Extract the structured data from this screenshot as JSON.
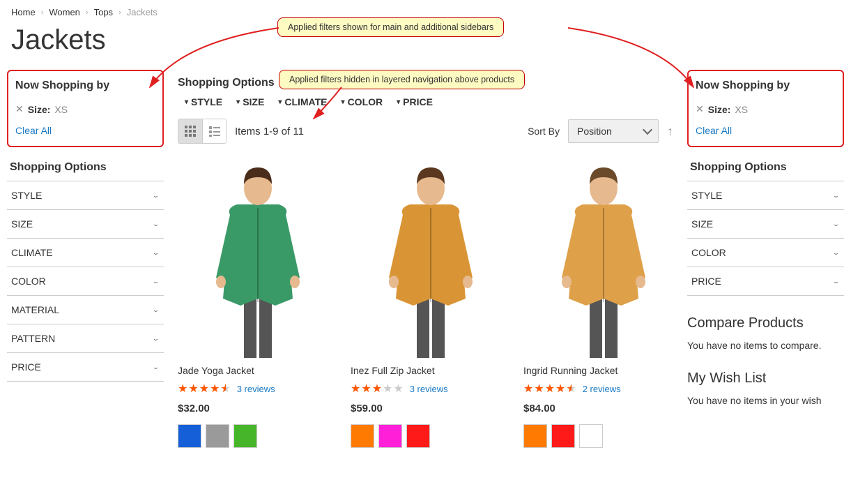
{
  "breadcrumbs": [
    {
      "label": "Home",
      "current": false
    },
    {
      "label": "Women",
      "current": false
    },
    {
      "label": "Tops",
      "current": false
    },
    {
      "label": "Jackets",
      "current": true
    }
  ],
  "page_title": "Jackets",
  "callouts": {
    "a": "Applied filters shown for main and additional sidebars",
    "b": "Applied filters hidden in layered navigation above products"
  },
  "now_shopping": {
    "title": "Now Shopping by",
    "filter_label": "Size:",
    "filter_value": "XS",
    "clear": "Clear All"
  },
  "shopping_options_title": "Shopping Options",
  "left_options": [
    "STYLE",
    "SIZE",
    "CLIMATE",
    "COLOR",
    "MATERIAL",
    "PATTERN",
    "PRICE"
  ],
  "right_options": [
    "STYLE",
    "SIZE",
    "COLOR",
    "PRICE"
  ],
  "hfilters": [
    "STYLE",
    "SIZE",
    "CLIMATE",
    "COLOR",
    "PRICE"
  ],
  "toolbar": {
    "count": "Items 1-9 of 11",
    "sort_label": "Sort By",
    "sort_value": "Position"
  },
  "products": [
    {
      "name": "Jade Yoga Jacket",
      "rating": 4.5,
      "reviews": "3 reviews",
      "price": "$32.00",
      "img_color": "#3a9a67",
      "swatches": [
        "#1560d8",
        "#9a9a9a",
        "#46b52a"
      ]
    },
    {
      "name": "Inez Full Zip Jacket",
      "rating": 3.0,
      "reviews": "3 reviews",
      "price": "$59.00",
      "img_color": "#d99535",
      "swatches": [
        "#ff7a00",
        "#ff1fd8",
        "#ff1a1a"
      ]
    },
    {
      "name": "Ingrid Running Jacket",
      "rating": 4.5,
      "reviews": "2 reviews",
      "price": "$84.00",
      "img_color": "#dfa04a",
      "swatches": [
        "#ff7a00",
        "#ff1a1a",
        "#ffffff"
      ]
    }
  ],
  "compare": {
    "title": "Compare Products",
    "empty": "You have no items to compare."
  },
  "wishlist": {
    "title": "My Wish List",
    "empty": "You have no items in your wish"
  }
}
